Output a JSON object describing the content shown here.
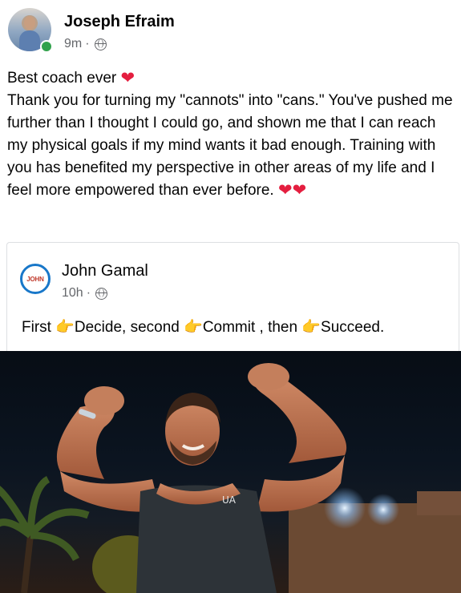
{
  "post": {
    "author": "Joseph Efraim",
    "time": "9m",
    "separator": "·",
    "line1": "Best coach ever",
    "body": "Thank you for turning my \"cannots\" into \"cans.\" You've pushed me further than I thought I could go, and shown me that I can reach my physical goals if my mind wants it bad enough. Training with you has benefited my perspective in other areas of my life and I feel more empowered than ever before.",
    "heart_glyph": "❤",
    "hearts_end": "❤❤"
  },
  "shared_post": {
    "author": "John Gamal",
    "time": "10h",
    "separator": "·",
    "avatar_text": "JOHN",
    "text_parts": [
      "First ",
      "Decide, second ",
      "Commit , then ",
      "Succeed."
    ],
    "point_glyph": "👉"
  },
  "photo": {
    "description_icon": "flexing-man-photo",
    "shirt_logo": "UA"
  },
  "colors": {
    "heart": "#e41e3f",
    "online": "#31a24c",
    "meta_gray": "#65676b",
    "avatar_ring": "#1877c9"
  }
}
